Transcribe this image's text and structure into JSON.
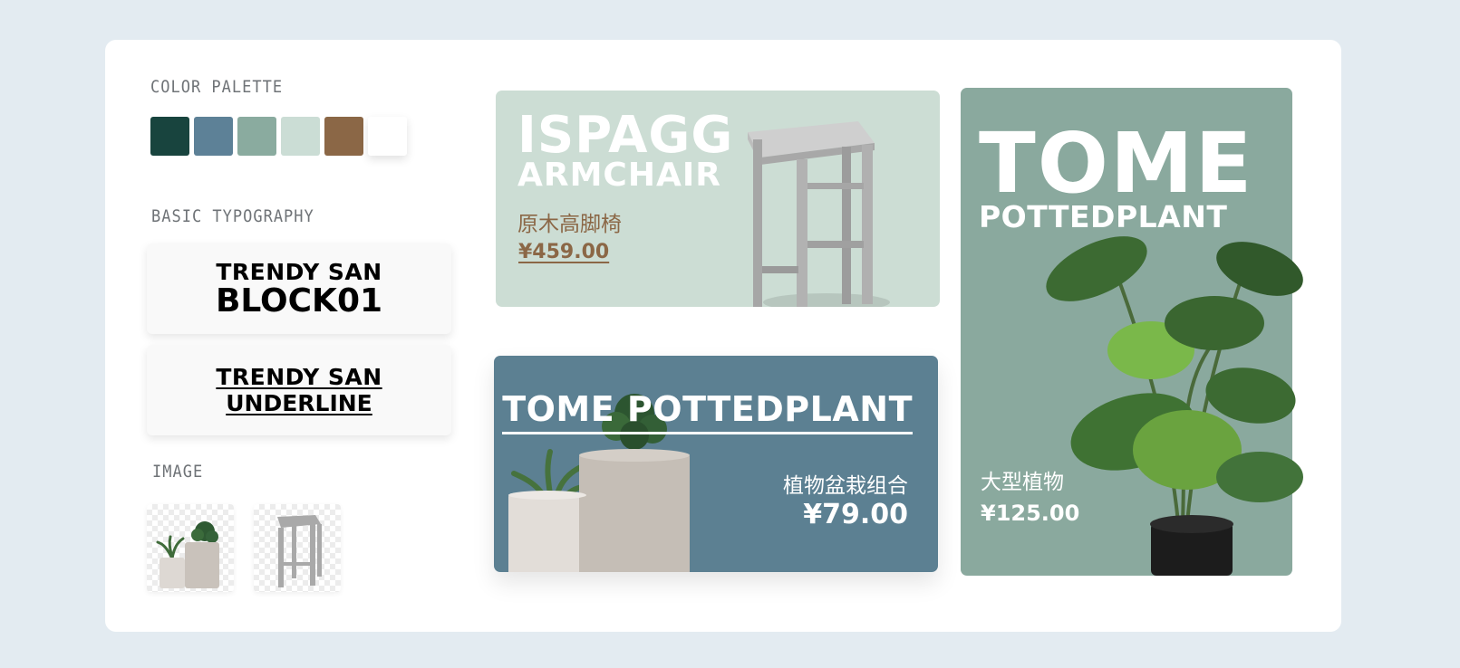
{
  "palette": {
    "title": "COLOR PALETTE",
    "colors": [
      "#18443e",
      "#5d8197",
      "#8aab9f",
      "#cbddd5",
      "#8b6746",
      "#ffffff"
    ]
  },
  "typography": {
    "title": "BASIC TYPOGRAPHY",
    "block": {
      "line1": "TRENDY SAN",
      "line2": "BLOCK01"
    },
    "underline": {
      "line1": "TRENDY SAN",
      "line2": "UNDERLINE"
    }
  },
  "image_section": {
    "title": "IMAGE"
  },
  "cards": {
    "stool": {
      "title1": "ISPAGG",
      "title2": "ARMCHAIR",
      "subtitle": "原木高脚椅",
      "price": "¥459.00"
    },
    "cactus": {
      "title": "TOME POTTEDPLANT",
      "subtitle": "植物盆栽组合",
      "price": "¥79.00"
    },
    "monstera": {
      "title1": "TOME",
      "title2": "POTTEDPLANT",
      "subtitle": "大型植物",
      "price": "¥125.00"
    }
  }
}
